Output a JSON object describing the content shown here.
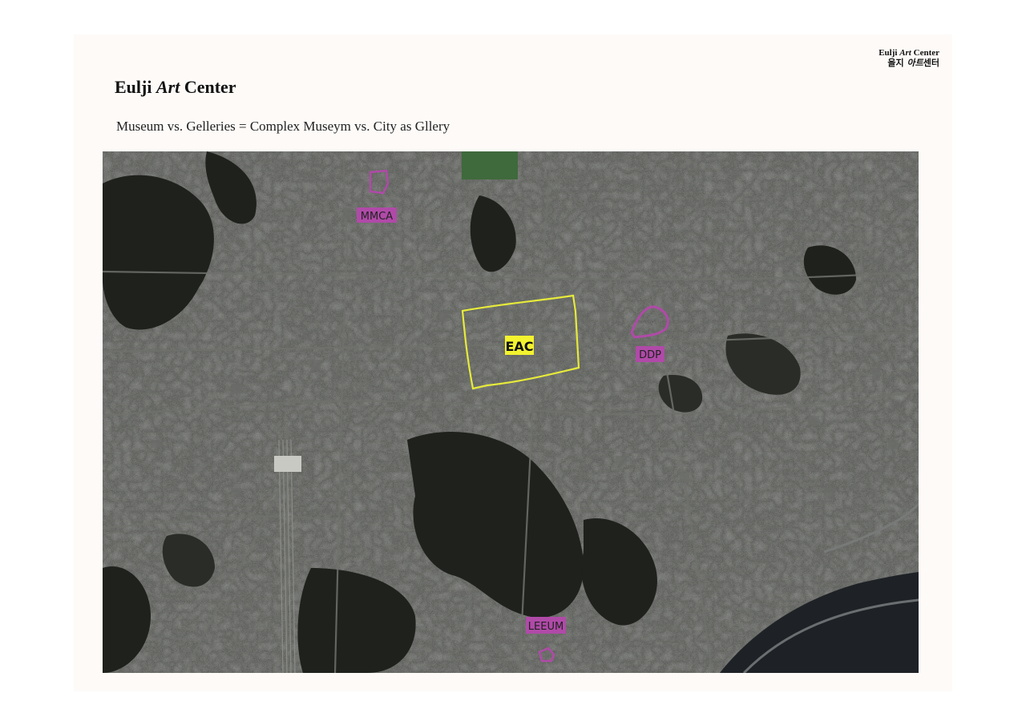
{
  "header": {
    "title_part1": "Eulji ",
    "title_italic": "Art",
    "title_part2": " Center",
    "subtitle": "Museum vs. Gelleries = Complex Museym vs. City as Gllery"
  },
  "corner_brand": {
    "en_part1": "Eulji ",
    "en_italic": "Art",
    "en_part2": " Center",
    "ko_part1": "을지 ",
    "ko_italic": "아트",
    "ko_part2": "센터"
  },
  "map": {
    "type": "satellite",
    "markers": [
      {
        "id": "mmca",
        "label": "MMCA",
        "color": "#b04aa8"
      },
      {
        "id": "eac",
        "label": "EAC",
        "color": "#e6ea3a"
      },
      {
        "id": "ddp",
        "label": "DDP",
        "color": "#b04aa8"
      },
      {
        "id": "leeum",
        "label": "LEEUM",
        "color": "#b04aa8"
      }
    ]
  },
  "colors": {
    "museum_marker": "#b04aa8",
    "eac_marker": "#e6ea3a",
    "page_background": "#fdfaf8"
  }
}
